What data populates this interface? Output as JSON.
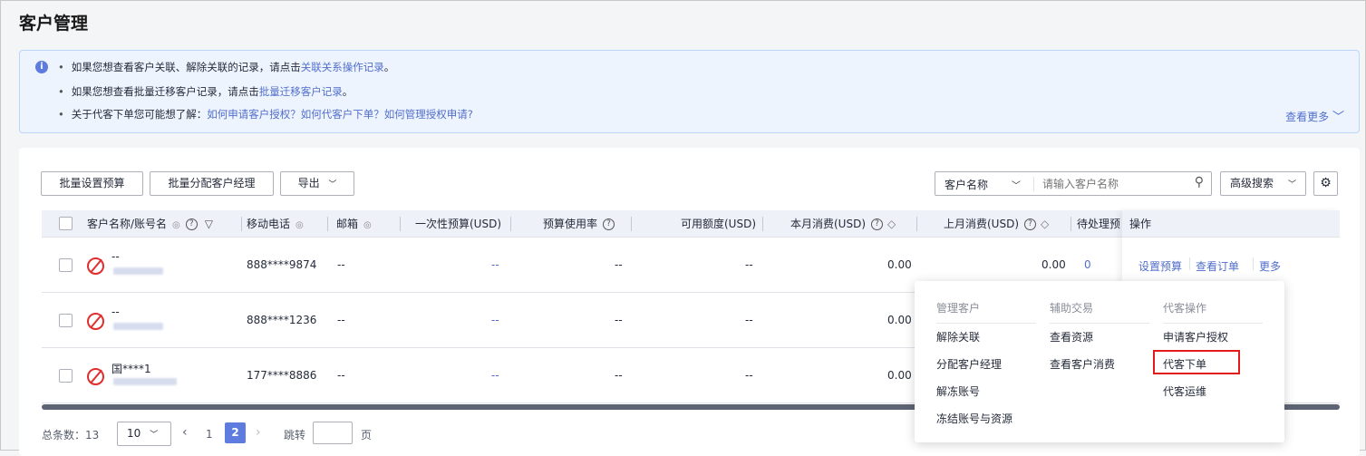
{
  "title": "客户管理",
  "info": {
    "line1_text": "如果您想查看客户关联、解除关联的记录，请点击",
    "line1_link": "关联关系操作记录",
    "line1_end": "。",
    "line2_text": "如果您想查看批量迁移客户记录，请点击",
    "line2_link": "批量迁移客户记录",
    "line2_end": "。",
    "line3_text": "关于代客下单您可能想了解：",
    "line3_links": [
      "如何申请客户授权？",
      "如何代客户下单？",
      "如何管理授权申请?"
    ],
    "more": "查看更多"
  },
  "toolbar": {
    "batch_budget": "批量设置预算",
    "batch_assign": "批量分配客户经理",
    "export": "导出",
    "search_field": "客户名称",
    "search_placeholder": "请输入客户名称",
    "advanced": "高级搜索"
  },
  "columns": [
    "客户名称/账号名",
    "移动电话",
    "邮箱",
    "一次性预算(USD)",
    "预算使用率",
    "可用额度(USD)",
    "本月消费(USD)",
    "上月消费(USD)",
    "待处理预",
    "操作"
  ],
  "rows": [
    {
      "name": "--",
      "phone": "888****9874",
      "email": "--",
      "budget": "--",
      "rate": "--",
      "available": "--",
      "month": "0.00",
      "last": "0.00",
      "pending": "0"
    },
    {
      "name": "--",
      "phone": "888****1236",
      "email": "--",
      "budget": "--",
      "rate": "--",
      "available": "--",
      "month": "0.00"
    },
    {
      "name": "国****1",
      "phone": "177****8886",
      "email": "--",
      "budget": "--",
      "rate": "--",
      "available": "--",
      "month": "0.00"
    }
  ],
  "actions": {
    "set_budget": "设置预算",
    "view_orders": "查看订单",
    "more": "更多"
  },
  "dropdown": {
    "groups": [
      {
        "title": "管理客户",
        "items": [
          "解除关联",
          "分配客户经理",
          "解冻账号",
          "冻结账号与资源"
        ]
      },
      {
        "title": "辅助交易",
        "items": [
          "查看资源",
          "查看客户消费"
        ]
      },
      {
        "title": "代客操作",
        "items": [
          "申请客户授权",
          "代客下单",
          "代客运维"
        ]
      }
    ],
    "highlighted": "代客下单"
  },
  "pagination": {
    "total_label": "总条数：",
    "total": "13",
    "page_size": "10",
    "pages": [
      "1",
      "2"
    ],
    "current": "2",
    "jump_label": "跳转",
    "page_unit": "页"
  }
}
